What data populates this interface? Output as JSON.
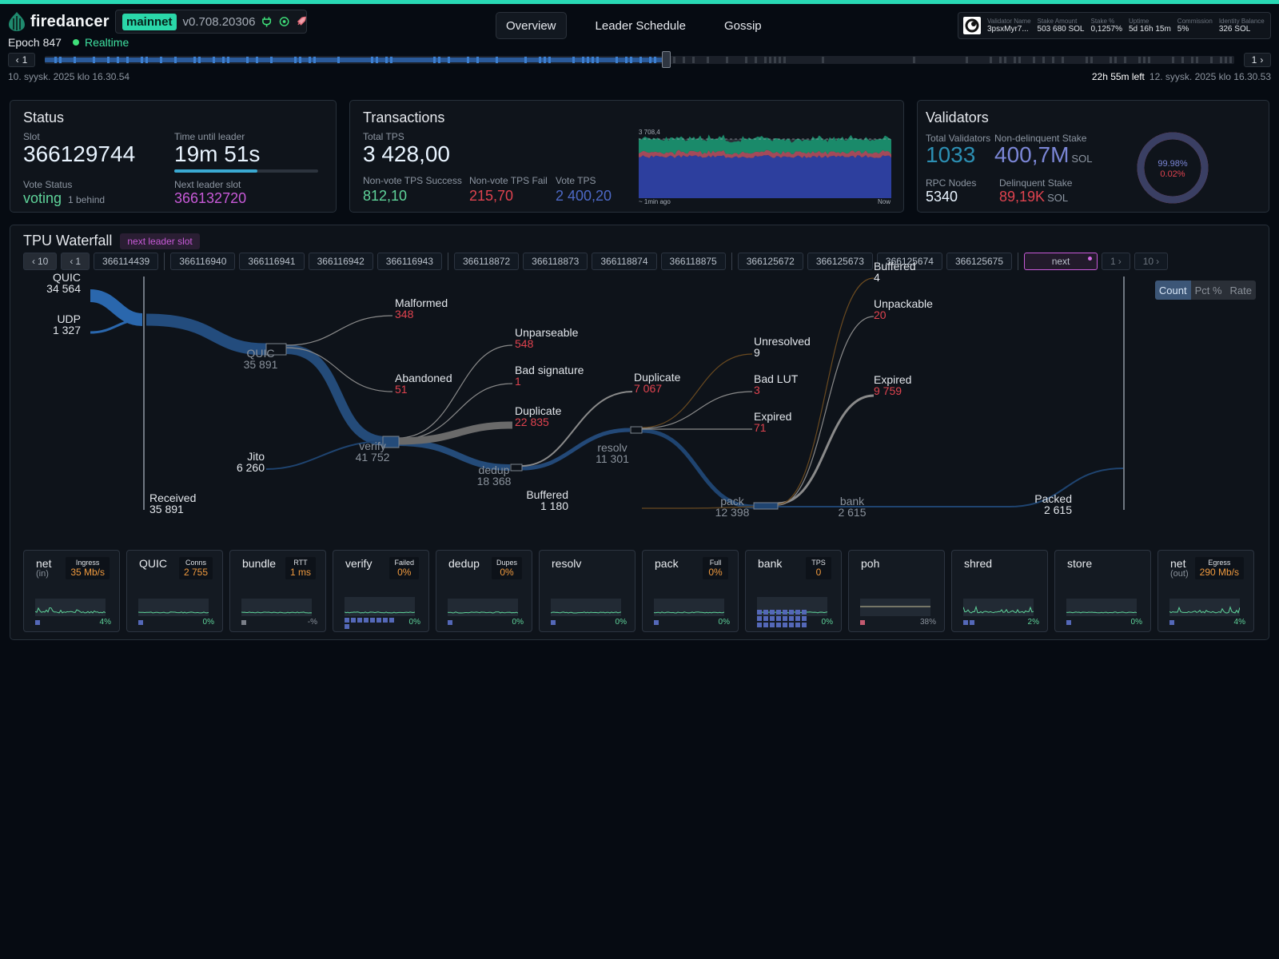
{
  "app": {
    "name": "firedancer",
    "network": "mainnet",
    "version": "v0.708.20306"
  },
  "nav": {
    "tabs": [
      "Overview",
      "Leader Schedule",
      "Gossip"
    ],
    "active": "Overview"
  },
  "identity": {
    "fields": [
      {
        "label": "Validator Name",
        "value": "3psxMyr7..."
      },
      {
        "label": "Stake Amount",
        "value": "503 680 SOL"
      },
      {
        "label": "Stake %",
        "value": "0,1257%"
      },
      {
        "label": "Uptime",
        "value": "5d 16h 15m"
      },
      {
        "label": "Commission",
        "value": "5%"
      },
      {
        "label": "Identity Balance",
        "value": "326 SOL"
      }
    ]
  },
  "epoch_bar": {
    "epoch": "Epoch 847",
    "realtime": "Realtime",
    "prev_step": "1",
    "next_step": "1",
    "start_date": "10. syysk. 2025 klo 16.30.54",
    "time_left": "22h 55m left",
    "end_date": "12. syysk. 2025 klo 16.30.53",
    "progress": 0.52
  },
  "status": {
    "title": "Status",
    "slot_label": "Slot",
    "slot": "366129744",
    "time_until_leader_label": "Time until leader",
    "time_until_leader": "19m 51s",
    "leader_progress": 0.58,
    "vote_status_label": "Vote Status",
    "vote_status": "voting",
    "vote_behind": "1 behind",
    "next_leader_slot_label": "Next leader slot",
    "next_leader_slot": "366132720"
  },
  "transactions": {
    "title": "Transactions",
    "total_tps_label": "Total TPS",
    "total_tps": "3 428,00",
    "nv_success_label": "Non-vote TPS Success",
    "nv_success": "812,10",
    "nv_fail_label": "Non-vote TPS Fail",
    "nv_fail": "215,70",
    "vote_tps_label": "Vote TPS",
    "vote_tps": "2 400,20",
    "chart_max": "3 708,4",
    "chart_start": "~ 1min ago",
    "chart_end": "Now"
  },
  "validators": {
    "title": "Validators",
    "total_label": "Total Validators",
    "total": "1033",
    "nondelinquent_label": "Non-delinquent Stake",
    "nondelinquent": "400,7M",
    "sol_unit": "SOL",
    "rpc_label": "RPC Nodes",
    "rpc": "5340",
    "delinquent_label": "Delinquent Stake",
    "delinquent": "89,19K",
    "pct_active": "99.98%",
    "pct_delinquent": "0.02%",
    "active_fraction": 0.9998
  },
  "tpu": {
    "title": "TPU Waterfall",
    "badge": "next leader slot",
    "back10": "10",
    "back1": "1",
    "slots": [
      [
        "366114439"
      ],
      [
        "366116940",
        "366116941",
        "366116942",
        "366116943"
      ],
      [
        "366118872",
        "366118873",
        "366118874",
        "366118875"
      ],
      [
        "366125672",
        "366125673",
        "366125674",
        "366125675"
      ]
    ],
    "next_label": "next",
    "fwd1": "1",
    "fwd10": "10",
    "view_modes": [
      "Count",
      "Pct %",
      "Rate"
    ],
    "nodes": {
      "quic_in": {
        "name": "QUIC",
        "value": "34 564"
      },
      "udp_in": {
        "name": "UDP",
        "value": "1 327"
      },
      "received": {
        "name": "Received",
        "value": "35 891"
      },
      "quic": {
        "name": "QUIC",
        "value": "35 891"
      },
      "malformed": {
        "name": "Malformed",
        "value": "348"
      },
      "abandoned": {
        "name": "Abandoned",
        "value": "51"
      },
      "jito": {
        "name": "Jito",
        "value": "6 260"
      },
      "verify": {
        "name": "verify",
        "value": "41 752"
      },
      "unparseable": {
        "name": "Unparseable",
        "value": "548"
      },
      "bad_signature": {
        "name": "Bad signature",
        "value": "1"
      },
      "duplicate_v": {
        "name": "Duplicate",
        "value": "22 835"
      },
      "dedup": {
        "name": "dedup",
        "value": "18 368"
      },
      "duplicate_d": {
        "name": "Duplicate",
        "value": "7 067"
      },
      "resolv": {
        "name": "resolv",
        "value": "11 301"
      },
      "unresolved": {
        "name": "Unresolved",
        "value": "9"
      },
      "bad_lut": {
        "name": "Bad LUT",
        "value": "3"
      },
      "expired_r": {
        "name": "Expired",
        "value": "71"
      },
      "buffered_in": {
        "name": "Buffered",
        "value": "1 180"
      },
      "pack": {
        "name": "pack",
        "value": "12 398"
      },
      "buffered_p": {
        "name": "Buffered",
        "value": "4"
      },
      "unpackable": {
        "name": "Unpackable",
        "value": "20"
      },
      "expired_p": {
        "name": "Expired",
        "value": "9 759"
      },
      "bank": {
        "name": "bank",
        "value": "2 615"
      },
      "packed": {
        "name": "Packed",
        "value": "2 615"
      }
    }
  },
  "tiles": [
    {
      "name": "net",
      "sub": "(in)",
      "metric_label": "Ingress",
      "metric_value": "35 Mb/s",
      "pct": "4%",
      "squares": 1
    },
    {
      "name": "QUIC",
      "sub": "",
      "metric_label": "Conns",
      "metric_value": "2 755",
      "pct": "0%",
      "squares": 1
    },
    {
      "name": "bundle",
      "sub": "",
      "metric_label": "RTT",
      "metric_value": "1 ms",
      "pct": "-%",
      "squares": 1
    },
    {
      "name": "verify",
      "sub": "",
      "metric_label": "Failed",
      "metric_value": "0%",
      "pct": "0%",
      "squares": 9
    },
    {
      "name": "dedup",
      "sub": "",
      "metric_label": "Dupes",
      "metric_value": "0%",
      "pct": "0%",
      "squares": 1
    },
    {
      "name": "resolv",
      "sub": "",
      "metric_label": "",
      "metric_value": "",
      "pct": "0%",
      "squares": 1
    },
    {
      "name": "pack",
      "sub": "",
      "metric_label": "Full",
      "metric_value": "0%",
      "pct": "0%",
      "squares": 1
    },
    {
      "name": "bank",
      "sub": "",
      "metric_label": "TPS",
      "metric_value": "0",
      "pct": "0%",
      "squares": 24
    },
    {
      "name": "poh",
      "sub": "",
      "metric_label": "",
      "metric_value": "",
      "pct": "38%",
      "squares": 1
    },
    {
      "name": "shred",
      "sub": "",
      "metric_label": "",
      "metric_value": "",
      "pct": "2%",
      "squares": 2
    },
    {
      "name": "store",
      "sub": "",
      "metric_label": "",
      "metric_value": "",
      "pct": "0%",
      "squares": 1
    },
    {
      "name": "net",
      "sub": "(out)",
      "metric_label": "Egress",
      "metric_value": "290 Mb/s",
      "pct": "4%",
      "squares": 1
    }
  ],
  "colors": {
    "accent": "#29d9b5",
    "success": "#5fd49a",
    "fail": "#e0434f",
    "vote": "#4d69c6",
    "leader": "#c85ad8",
    "warn": "#f09a3e",
    "flow": "#2c5e99"
  }
}
